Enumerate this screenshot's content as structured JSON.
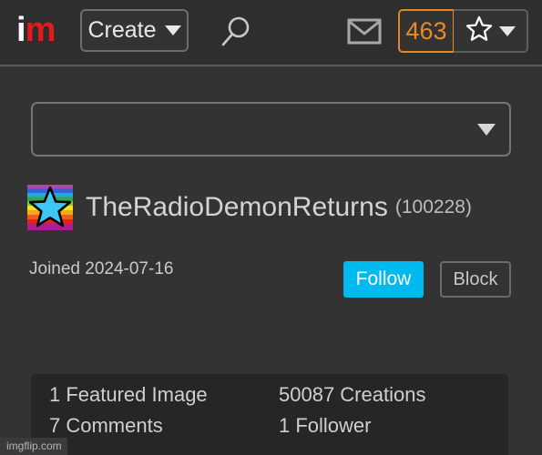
{
  "header": {
    "logo": {
      "first": "i",
      "second": "m",
      "color_white": "#ffffff",
      "color_red": "#e21b1b"
    },
    "create_label": "Create",
    "create_caret": "chevron-down-icon",
    "search_icon": "search-icon",
    "mail_icon": "envelope-icon",
    "points_value": "463",
    "points_color": "#e78b22",
    "star_icon": "star-outline-icon",
    "user_caret": "chevron-down-icon"
  },
  "page_select": {
    "value": "",
    "caret": "chevron-down-icon"
  },
  "profile": {
    "avatar_name": "rainbow-star-avatar",
    "username": "TheRadioDemonReturns",
    "user_id": "(100228)",
    "joined": "Joined 2024-07-16",
    "follow_label": "Follow",
    "follow_color": "#00b9ef",
    "block_label": "Block"
  },
  "stats": {
    "featured_images": "1 Featured Image",
    "creations": "50087 Creations",
    "comments": "7 Comments",
    "followers": "1 Follower"
  },
  "watermark": "imgflip.com"
}
